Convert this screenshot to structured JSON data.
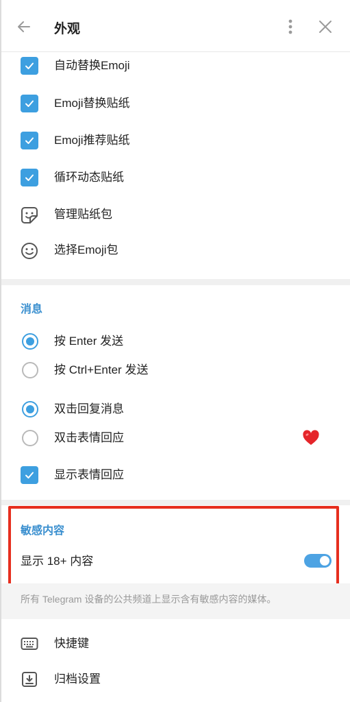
{
  "header": {
    "title": "外观",
    "back_icon": "arrow-left-icon",
    "menu_icon": "more-vertical-icon",
    "close_icon": "close-icon"
  },
  "stickers_emoji": {
    "items": [
      {
        "type": "checkbox",
        "checked": true,
        "label": "自动替换Emoji"
      },
      {
        "type": "checkbox",
        "checked": true,
        "label": "Emoji替换贴纸"
      },
      {
        "type": "checkbox",
        "checked": true,
        "label": "Emoji推荐贴纸"
      },
      {
        "type": "checkbox",
        "checked": true,
        "label": "循环动态贴纸"
      },
      {
        "type": "icon",
        "icon": "sticker-icon",
        "label": "管理贴纸包"
      },
      {
        "type": "icon",
        "icon": "smile-icon",
        "label": "选择Emoji包"
      }
    ]
  },
  "messages": {
    "title": "消息",
    "send_options": [
      {
        "label": "按 Enter 发送",
        "selected": true
      },
      {
        "label": "按 Ctrl+Enter 发送",
        "selected": false
      }
    ],
    "double_click_options": [
      {
        "label": "双击回复消息",
        "selected": true
      },
      {
        "label": "双击表情回应",
        "selected": false,
        "reaction_icon": "heart-icon"
      }
    ],
    "show_reactions": {
      "label": "显示表情回应",
      "checked": true
    }
  },
  "sensitive": {
    "title": "敏感内容",
    "toggle_label": "显示 18+ 内容",
    "toggle_on": true,
    "hint": "所有 Telegram 设备的公共频道上显示含有敏感内容的媒体。"
  },
  "misc": {
    "items": [
      {
        "icon": "keyboard-icon",
        "label": "快捷键"
      },
      {
        "icon": "archive-icon",
        "label": "归档设置"
      }
    ]
  },
  "colors": {
    "accent": "#3d9fe0",
    "section_title": "#3a8fcf",
    "highlight": "#e62e1e"
  }
}
